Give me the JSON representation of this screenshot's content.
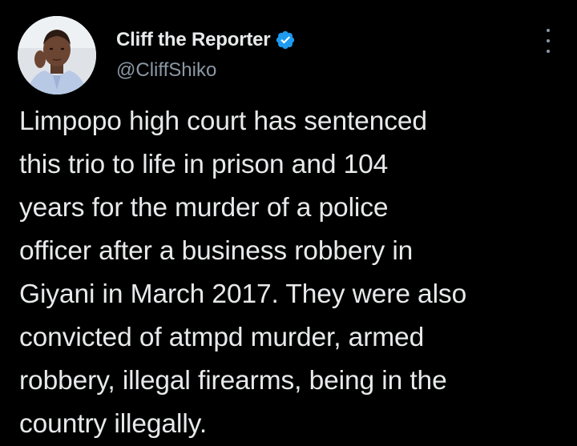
{
  "author": {
    "display_name": "Cliff the Reporter",
    "handle": "@CliffShiko",
    "verified": true
  },
  "tweet": {
    "lines": [
      "Limpopo high court has sentenced",
      "this trio to life in prison and 104",
      "years for the murder of a police",
      "officer after a business robbery in",
      "Giyani in March 2017. They were also",
      "convicted of atmpd murder, armed",
      "robbery, illegal firearms, being in the",
      "country illegally."
    ]
  },
  "icons": {
    "verified": "verified-badge-icon",
    "more": "more-options-icon"
  },
  "colors": {
    "background": "#000000",
    "primary_text": "#e7e9ea",
    "secondary_text": "#8b98a5",
    "verified_blue": "#1d9bf0"
  }
}
